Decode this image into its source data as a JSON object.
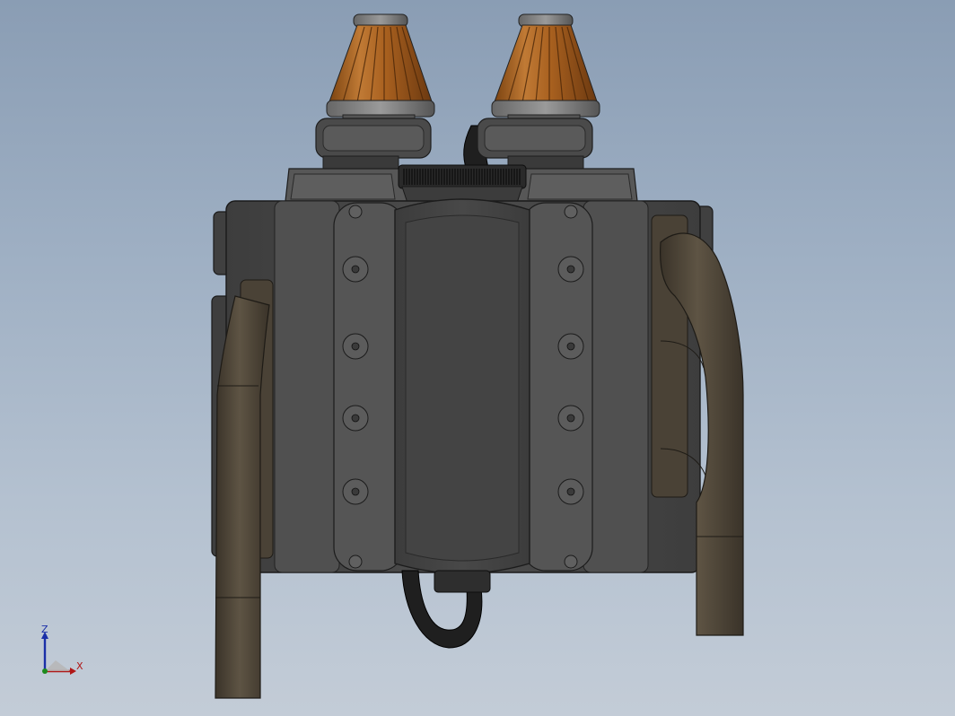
{
  "view": {
    "background_top": "#8a9db4",
    "background_bottom": "#c3ccd7"
  },
  "model": {
    "icons": [
      "engine-block-icon",
      "air-filter-icon",
      "exhaust-header-icon",
      "throttle-body-icon"
    ],
    "colors": {
      "block": "#4f4f4f",
      "block_dark": "#3a3a3a",
      "valve_cover": "#565656",
      "intake": "#474747",
      "filter": "#b06a2a",
      "filter_dark": "#6e3c12",
      "exhaust": "#554b3d",
      "exhaust_dark": "#3a3329",
      "hose": "#1f1f1f"
    }
  },
  "triad": {
    "z_label": "Z",
    "x_label": "X",
    "z_color": "#1a2fa8",
    "x_color": "#b01818",
    "y_color": "#1c8a1c"
  }
}
